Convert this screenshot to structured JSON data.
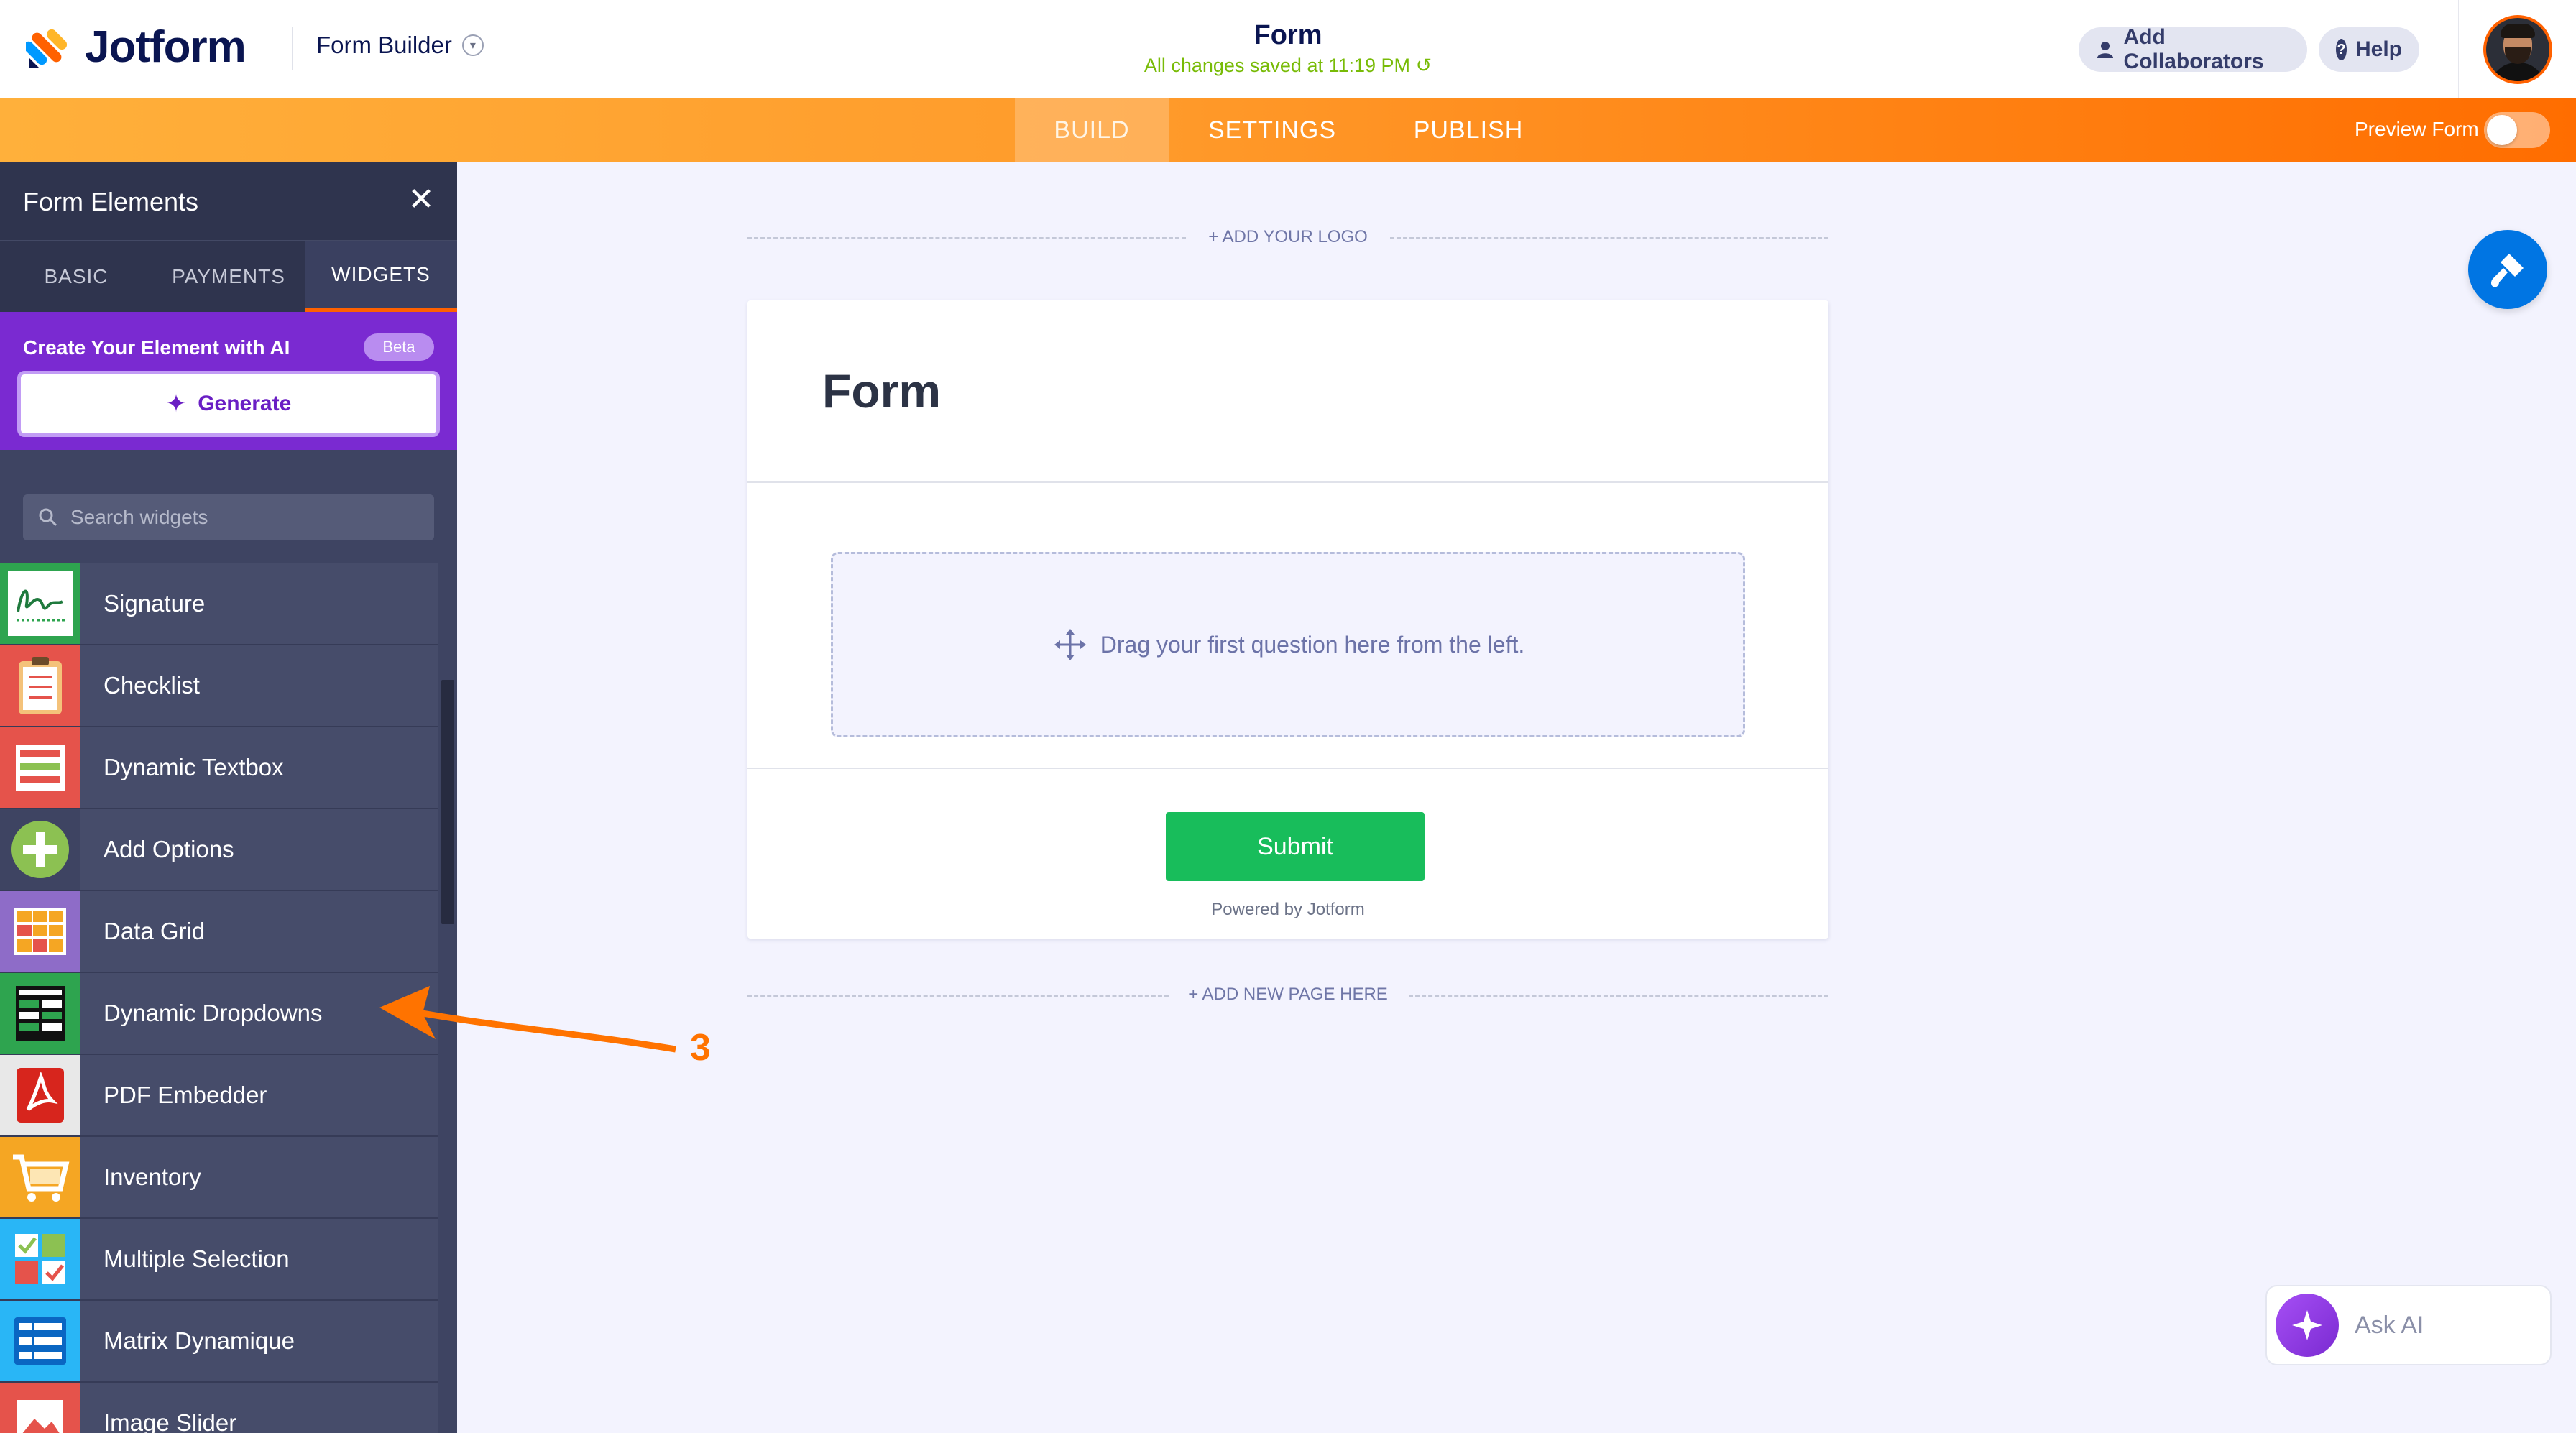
{
  "header": {
    "brand": "Jotform",
    "builder_label": "Form Builder",
    "form_title": "Form",
    "save_status": "All changes saved at 11:19 PM",
    "add_collaborators": "Add Collaborators",
    "help": "Help"
  },
  "nav": {
    "tabs": [
      {
        "label": "BUILD",
        "active": true
      },
      {
        "label": "SETTINGS",
        "active": false
      },
      {
        "label": "PUBLISH",
        "active": false
      }
    ],
    "preview_label": "Preview Form",
    "preview_on": false
  },
  "sidebar": {
    "title": "Form Elements",
    "tabs": [
      "BASIC",
      "PAYMENTS",
      "WIDGETS"
    ],
    "active_tab": "WIDGETS",
    "ai": {
      "title": "Create Your Element with AI",
      "badge": "Beta",
      "generate": "Generate"
    },
    "search_placeholder": "Search widgets",
    "widgets": [
      {
        "label": "Signature",
        "icon": "signature-icon",
        "color": "#2ea44f"
      },
      {
        "label": "Checklist",
        "icon": "clipboard-checklist-icon",
        "color": "#e5534b"
      },
      {
        "label": "Dynamic Textbox",
        "icon": "textbox-lines-icon",
        "color": "#e5534b"
      },
      {
        "label": "Add Options",
        "icon": "plus-circle-icon",
        "color": "#2ea44f"
      },
      {
        "label": "Data Grid",
        "icon": "grid-table-icon",
        "color": "#8e6cc8"
      },
      {
        "label": "Dynamic Dropdowns",
        "icon": "dropdown-table-icon",
        "color": "#2ea44f"
      },
      {
        "label": "PDF Embedder",
        "icon": "pdf-icon",
        "color": "#e0e0e0"
      },
      {
        "label": "Inventory",
        "icon": "cart-icon",
        "color": "#f5a623"
      },
      {
        "label": "Multiple Selection",
        "icon": "multi-check-icon",
        "color": "#29b6f6"
      },
      {
        "label": "Matrix Dynamique",
        "icon": "matrix-table-icon",
        "color": "#29b6f6"
      },
      {
        "label": "Image Slider",
        "icon": "image-slider-icon",
        "color": "#e5534b"
      }
    ]
  },
  "canvas": {
    "add_logo": "+ ADD YOUR LOGO",
    "form_heading": "Form",
    "drop_hint": "Drag your first question here from the left.",
    "submit": "Submit",
    "powered": "Powered by Jotform",
    "add_page": "+ ADD NEW PAGE HERE"
  },
  "annotation": {
    "number": "3",
    "color": "#ff7300"
  },
  "ask_ai": "Ask AI",
  "colors": {
    "accent": "#ff6100",
    "navy": "#0a1551",
    "sidebar": "#3e4462",
    "ai_purple": "#7a2ad1",
    "submit_green": "#18bd5b",
    "save_green": "#78bb07"
  }
}
